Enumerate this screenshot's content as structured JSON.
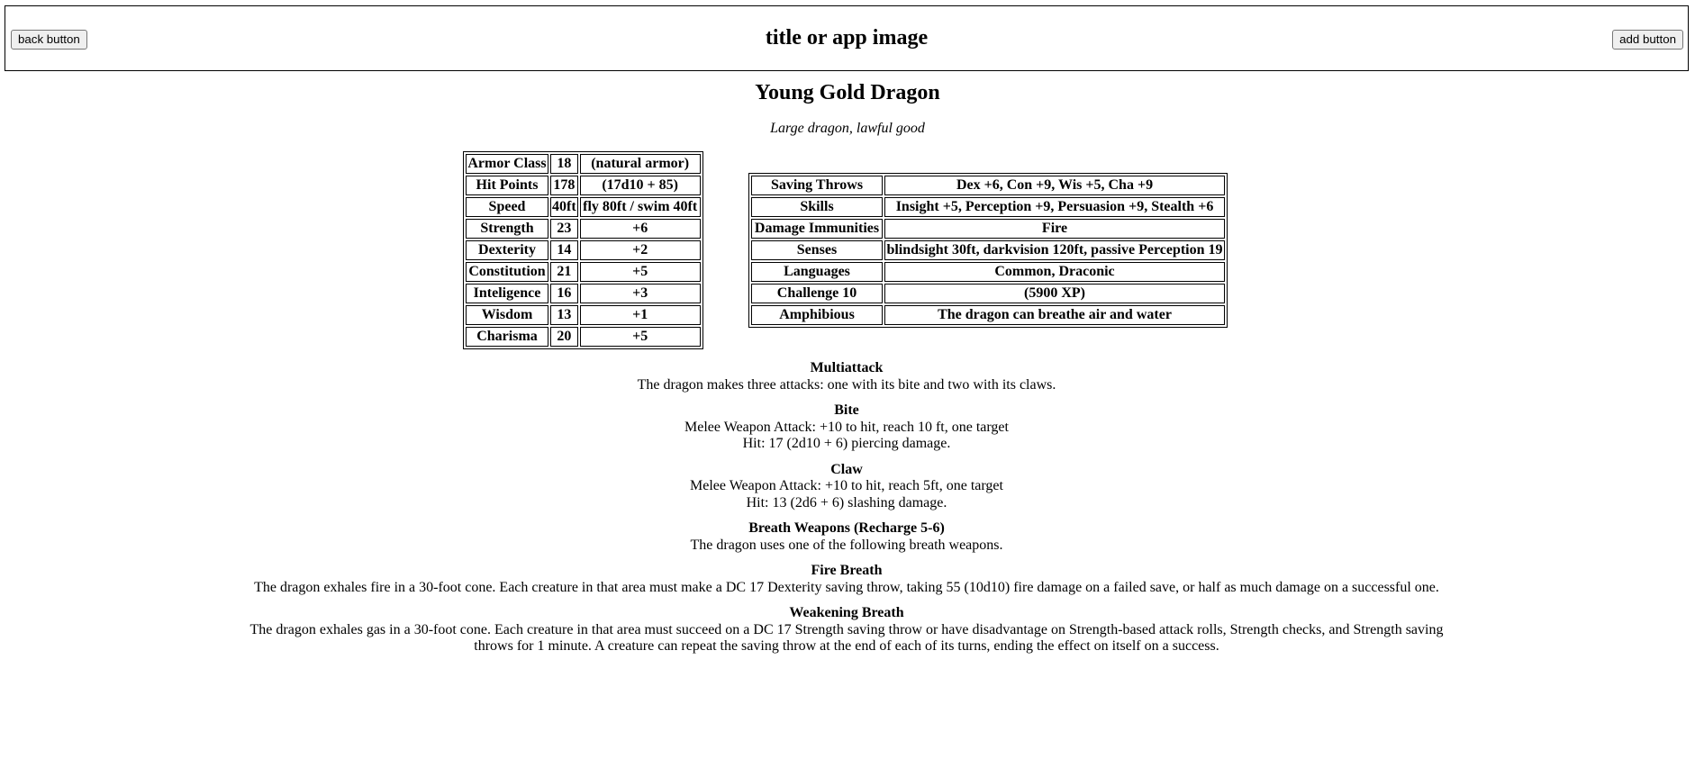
{
  "header": {
    "back_label": "back button",
    "title": "title or app image",
    "add_label": "add button"
  },
  "monster": {
    "name": "Young Gold Dragon",
    "type": "Large dragon, lawful good"
  },
  "attributes": [
    {
      "label": "Armor Class",
      "value": "18",
      "detail": "(natural armor)"
    },
    {
      "label": "Hit Points",
      "value": "178",
      "detail": "(17d10 + 85)"
    },
    {
      "label": "Speed",
      "value": "40ft",
      "detail": "fly 80ft / swim 40ft"
    },
    {
      "label": "Strength",
      "value": "23",
      "detail": "+6"
    },
    {
      "label": "Dexterity",
      "value": "14",
      "detail": "+2"
    },
    {
      "label": "Constitution",
      "value": "21",
      "detail": "+5"
    },
    {
      "label": "Inteligence",
      "value": "16",
      "detail": "+3"
    },
    {
      "label": "Wisdom",
      "value": "13",
      "detail": "+1"
    },
    {
      "label": "Charisma",
      "value": "20",
      "detail": "+5"
    }
  ],
  "features": [
    {
      "label": "Saving Throws",
      "value": "Dex +6, Con +9, Wis +5, Cha +9"
    },
    {
      "label": "Skills",
      "value": "Insight +5, Perception +9, Persuasion +9, Stealth +6"
    },
    {
      "label": "Damage Immunities",
      "value": "Fire"
    },
    {
      "label": "Senses",
      "value": "blindsight 30ft, darkvision 120ft, passive Perception 19"
    },
    {
      "label": "Languages",
      "value": "Common, Draconic"
    },
    {
      "label": "Challenge 10",
      "value": "(5900 XP)"
    },
    {
      "label": "Amphibious",
      "value": "The dragon can breathe air and water"
    }
  ],
  "actions": [
    {
      "name": "Multiattack",
      "lines": [
        "The dragon makes three attacks: one with its bite and two with its claws."
      ]
    },
    {
      "name": "Bite",
      "lines": [
        "Melee Weapon Attack: +10 to hit, reach 10 ft, one target",
        "Hit: 17 (2d10 + 6) piercing damage."
      ]
    },
    {
      "name": "Claw",
      "lines": [
        "Melee Weapon Attack: +10 to hit, reach 5ft, one target",
        "Hit: 13 (2d6 + 6) slashing damage."
      ]
    },
    {
      "name": "Breath Weapons (Recharge 5-6)",
      "lines": [
        "The dragon uses one of the following breath weapons."
      ]
    },
    {
      "name": "Fire Breath",
      "lines": [
        "The dragon exhales fire in a 30-foot cone. Each creature in that area must make a DC 17 Dexterity saving throw, taking 55 (10d10) fire damage on a failed save, or half as much damage on a successful one."
      ]
    },
    {
      "name": "Weakening Breath",
      "lines": [
        "The dragon exhales gas in a 30-foot cone. Each creature in that area must succeed on a DC 17 Strength saving throw or have disadvantage on Strength-based attack rolls, Strength checks, and Strength saving throws for 1 minute. A creature can repeat the saving throw at the end of each of its turns, ending the effect on itself on a success."
      ]
    }
  ]
}
